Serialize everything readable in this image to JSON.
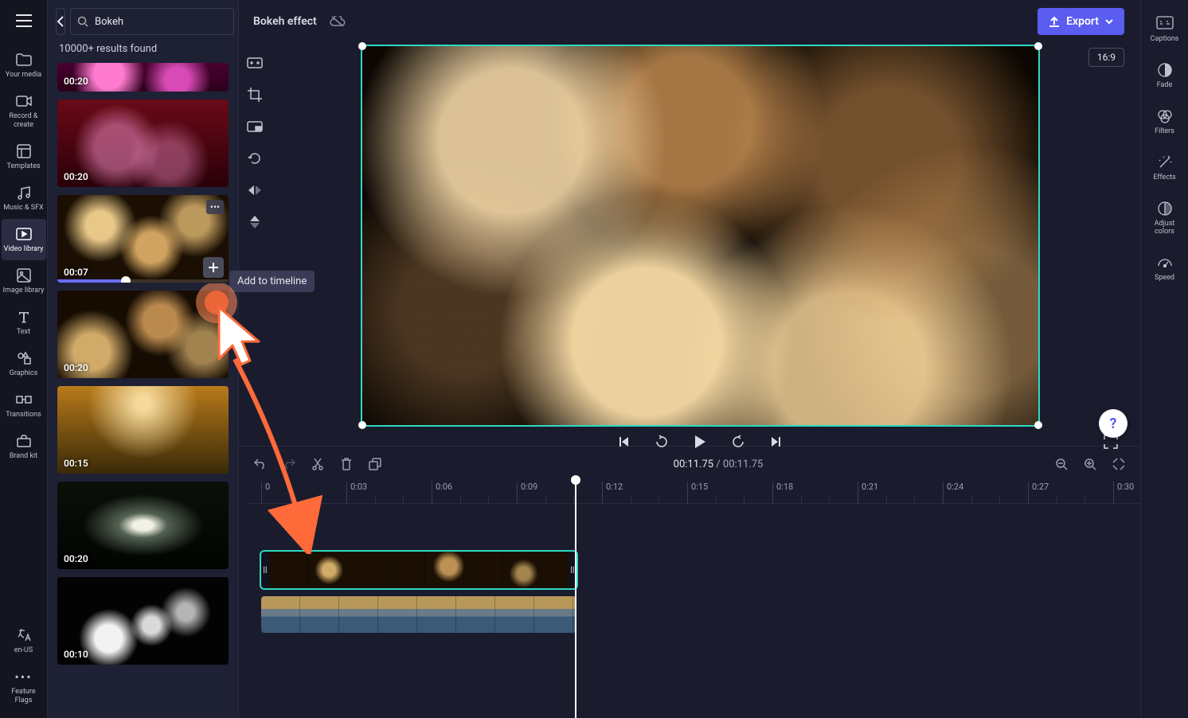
{
  "rail": {
    "items": [
      {
        "label": "Your media"
      },
      {
        "label": "Record & create"
      },
      {
        "label": "Templates"
      },
      {
        "label": "Music & SFX"
      },
      {
        "label": "Video library"
      },
      {
        "label": "Image library"
      },
      {
        "label": "Text"
      },
      {
        "label": "Graphics"
      },
      {
        "label": "Transitions"
      },
      {
        "label": "Brand kit"
      }
    ],
    "bottom": [
      {
        "label": "en-US"
      },
      {
        "label": "Feature Flags"
      }
    ]
  },
  "library": {
    "search_value": "Bokeh",
    "results": "10000+ results found",
    "clips": [
      {
        "duration": "00:20",
        "variant": "pink"
      },
      {
        "duration": "00:20",
        "variant": "redpink"
      },
      {
        "duration": "00:07",
        "variant": "gold",
        "active": true
      },
      {
        "duration": "00:20",
        "variant": "gold2"
      },
      {
        "duration": "00:15",
        "variant": "amber"
      },
      {
        "duration": "00:20",
        "variant": "flare"
      },
      {
        "duration": "00:10",
        "variant": "white"
      }
    ],
    "tooltip": "Add to timeline"
  },
  "project": {
    "title": "Bokeh effect",
    "export_label": "Export",
    "ratio": "16:9"
  },
  "playback": {
    "current": "00:11.75",
    "total": "00:11.75"
  },
  "ruler": {
    "ticks": [
      "0",
      "0:03",
      "0:06",
      "0:09",
      "0:12",
      "0:15",
      "0:18",
      "0:21",
      "0:24",
      "0:27",
      "0:30"
    ]
  },
  "right_rail": {
    "items": [
      {
        "label": "Captions"
      },
      {
        "label": "Fade"
      },
      {
        "label": "Filters"
      },
      {
        "label": "Effects"
      },
      {
        "label": "Adjust colors"
      },
      {
        "label": "Speed"
      }
    ]
  },
  "help": "?"
}
